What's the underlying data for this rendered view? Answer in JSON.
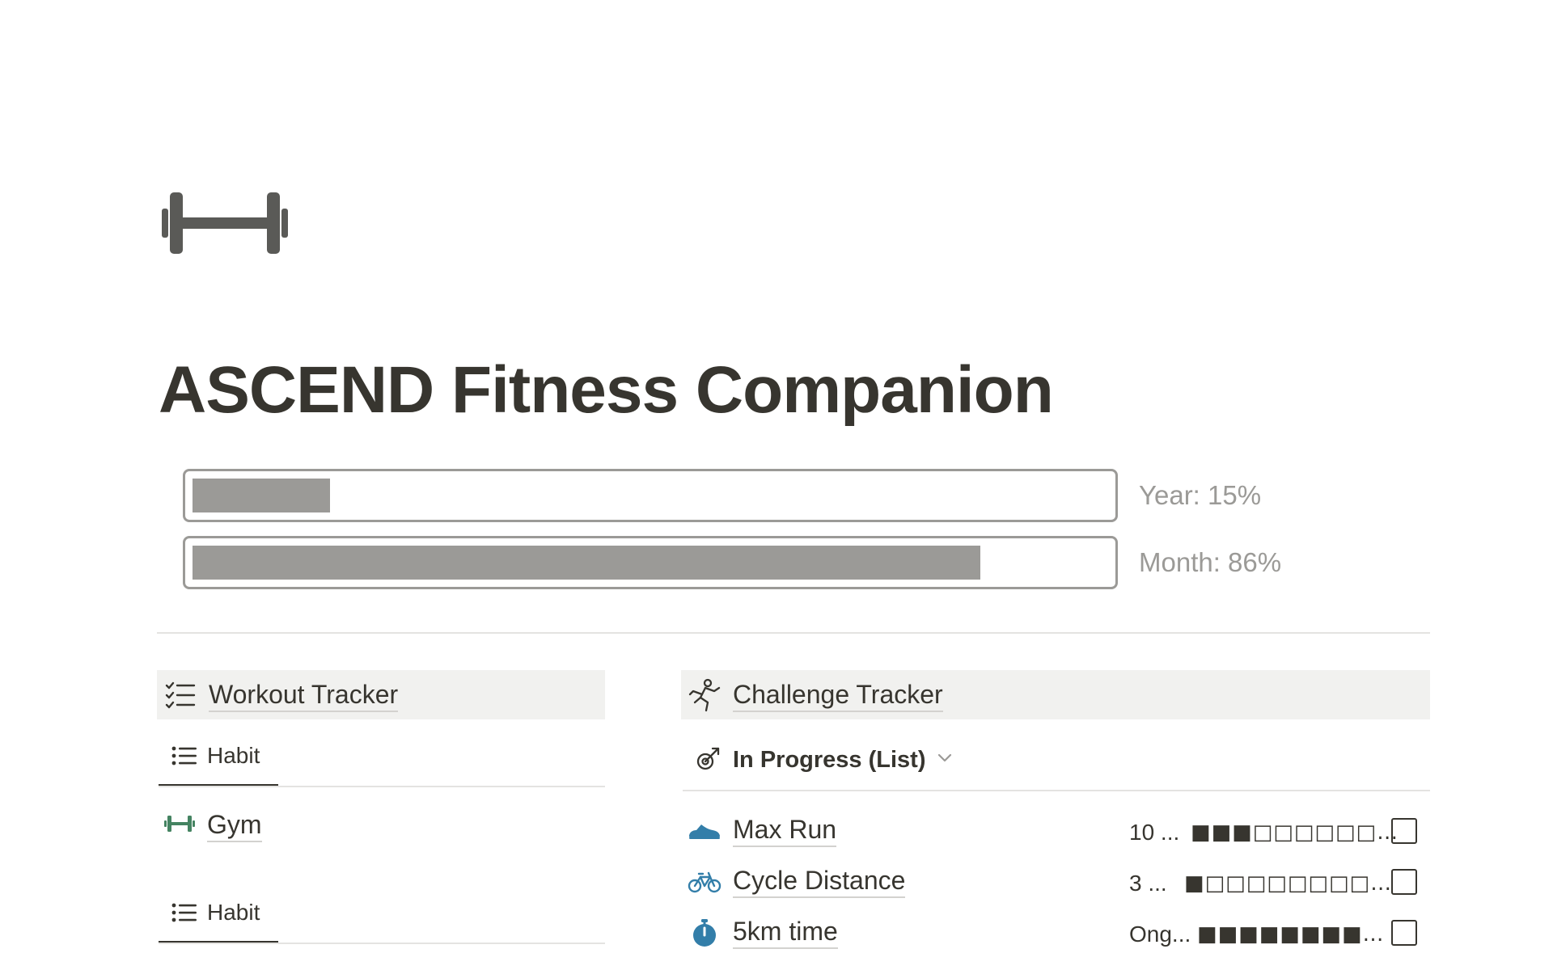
{
  "page": {
    "icon": "dumbbell-icon",
    "title": "ASCEND Fitness Companion"
  },
  "progress": [
    {
      "label": "Year: 15%",
      "value": 0.15
    },
    {
      "label": "Month: 86%",
      "value": 0.86
    }
  ],
  "workout_tracker": {
    "title": "Workout Tracker",
    "icon": "checklist-icon",
    "views": [
      {
        "label": "Habit",
        "icon": "list-icon"
      },
      {
        "label": "Habit",
        "icon": "list-icon"
      }
    ],
    "items": [
      {
        "label": "Gym",
        "icon": "dumbbell-icon"
      }
    ]
  },
  "challenge_tracker": {
    "title": "Challenge Tracker",
    "icon": "running-person-icon",
    "view_label": "In Progress (List)",
    "view_icon": "target-arrow-icon",
    "rows": [
      {
        "title": "Max Run",
        "icon": "shoe-icon",
        "goal": "10 ...",
        "progress_text": "■■■□□□□□□…",
        "completed": false
      },
      {
        "title": "Cycle Distance",
        "icon": "bicycle-icon",
        "goal": "3 ...",
        "progress_text": "■□□□□□□□□…",
        "completed": false
      },
      {
        "title": "5km time",
        "icon": "stopwatch-icon",
        "goal": "Ong...",
        "progress_text": "■■■■■■■■…",
        "completed": false
      }
    ]
  },
  "colors": {
    "text": "#37352f",
    "muted": "#9b9a97",
    "header_bg": "#f1f1ef",
    "accent_green": "#448361",
    "accent_blue": "#337ea9",
    "icon_gray": "#5a5a57"
  }
}
